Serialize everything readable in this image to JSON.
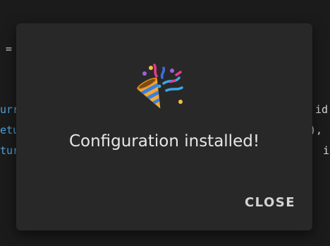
{
  "background_code": {
    "fragment_eq": "=",
    "left_lines": [
      "urr",
      "etu",
      "tur"
    ],
    "right_lines": [
      "id",
      "),",
      "i"
    ]
  },
  "dialog": {
    "icon": "party-popper-icon",
    "message": "Configuration installed!",
    "close_label": "CLOSE"
  },
  "colors": {
    "dialog_bg": "#282828",
    "page_bg": "#1b1b1b",
    "text": "#e6e6e6",
    "code_keyword": "#4fa3d9"
  }
}
